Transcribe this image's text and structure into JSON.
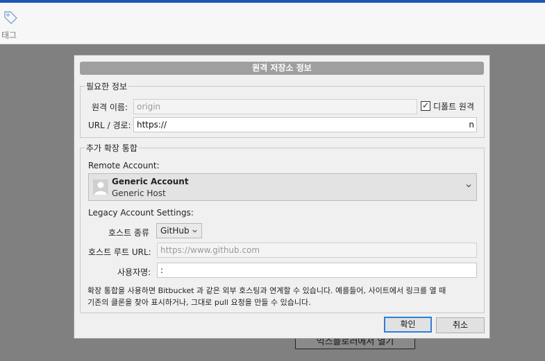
{
  "app": {
    "toolbar": {
      "tag_label": "태그"
    },
    "background_button": "익스플로러에서 열기"
  },
  "dialog": {
    "title": "원격 저장소 정보",
    "required_group": {
      "legend": "필요한 정보",
      "remote_name_label": "원격 이름:",
      "remote_name_placeholder": "origin",
      "default_remote_label": "디폴트 원격",
      "default_remote_checked": true,
      "url_label": "URL / 경로:",
      "url_value_start": "https://",
      "url_value_end": "n"
    },
    "extra_group": {
      "legend": "추가 확장 통합",
      "remote_account_label": "Remote Account:",
      "account_name": "Generic Account",
      "account_host": "Generic Host",
      "legacy_label": "Legacy Account Settings:",
      "host_type_label": "호스트 종류",
      "host_type_value": "GitHub",
      "host_root_url_label": "호스트 루트 URL:",
      "host_root_url_placeholder": "https://www.github.com",
      "username_label": "사용자명:",
      "username_value": ":",
      "help_line1": "확장 통합을 사용하면 Bitbucket 과 같은 외부 호스팅과 연계할 수 있습니다. 예를들어, 사이트에서 링크를 열 때",
      "help_line2": "기존의 클론을 찾아 표시하거나, 그대로 pull 요청을 만들 수 있습니다."
    },
    "ok_label": "확인",
    "cancel_label": "취소"
  }
}
